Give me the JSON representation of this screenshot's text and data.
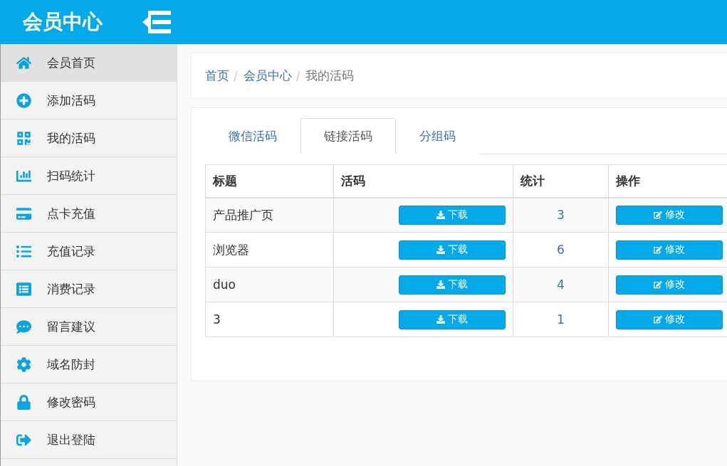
{
  "header": {
    "title": "会员中心"
  },
  "sidebar": {
    "items": [
      {
        "label": "会员首页",
        "selected": true
      },
      {
        "label": "添加活码",
        "selected": false
      },
      {
        "label": "我的活码",
        "selected": false
      },
      {
        "label": "扫码统计",
        "selected": false
      },
      {
        "label": "点卡充值",
        "selected": false
      },
      {
        "label": "充值记录",
        "selected": false
      },
      {
        "label": "消费记录",
        "selected": false
      },
      {
        "label": "留言建议",
        "selected": false
      },
      {
        "label": "域名防封",
        "selected": false
      },
      {
        "label": "修改密码",
        "selected": false
      },
      {
        "label": "退出登陆",
        "selected": false
      }
    ]
  },
  "breadcrumb_separator": "/",
  "breadcrumb": [
    {
      "label": "首页",
      "current": false
    },
    {
      "label": "会员中心",
      "current": false
    },
    {
      "label": "我的活码",
      "current": true
    }
  ],
  "tabs": [
    {
      "label": "微信活码",
      "selected": false
    },
    {
      "label": "链接活码",
      "selected": true
    },
    {
      "label": "分组码",
      "selected": false
    }
  ],
  "table": {
    "columns": [
      "标题",
      "活码",
      "统计",
      "操作"
    ],
    "rows": [
      {
        "title": "产品推广页",
        "download": "下载",
        "count": "3",
        "edit": "修改"
      },
      {
        "title": "浏览器",
        "download": "下载",
        "count": "6",
        "edit": "修改"
      },
      {
        "title": "duo",
        "download": "下载",
        "count": "4",
        "edit": "修改"
      },
      {
        "title": "3",
        "download": "下载",
        "count": "1",
        "edit": "修改"
      }
    ]
  }
}
